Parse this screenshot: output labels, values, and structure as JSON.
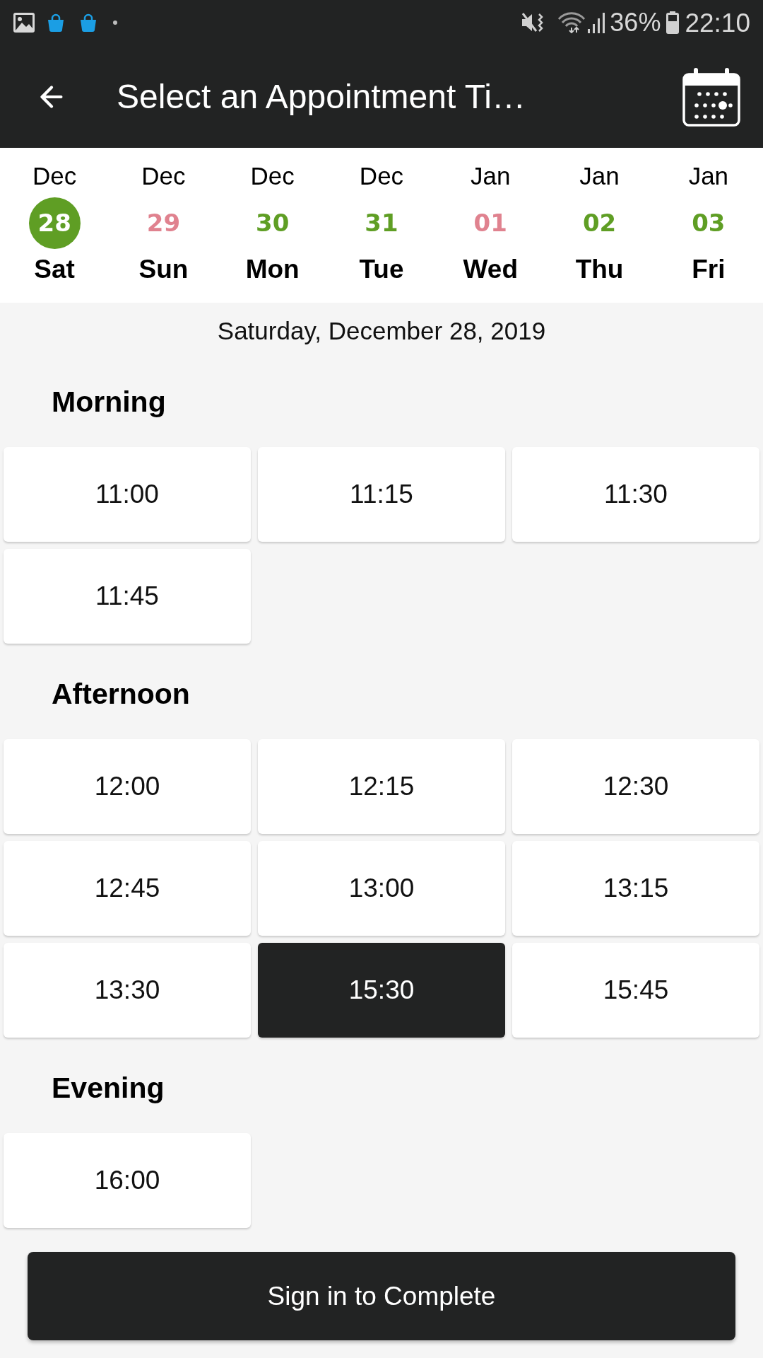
{
  "status_bar": {
    "battery": "36%",
    "time": "22:10"
  },
  "header": {
    "title": "Select an Appointment Ti…"
  },
  "days": [
    {
      "month": "Dec",
      "day": "28",
      "weekday": "Sat",
      "color": "#5f9e24",
      "selected": true
    },
    {
      "month": "Dec",
      "day": "29",
      "weekday": "Sun",
      "color": "#e0828f",
      "selected": false
    },
    {
      "month": "Dec",
      "day": "30",
      "weekday": "Mon",
      "color": "#5f9e24",
      "selected": false
    },
    {
      "month": "Dec",
      "day": "31",
      "weekday": "Tue",
      "color": "#5f9e24",
      "selected": false
    },
    {
      "month": "Jan",
      "day": "01",
      "weekday": "Wed",
      "color": "#e0828f",
      "selected": false
    },
    {
      "month": "Jan",
      "day": "02",
      "weekday": "Thu",
      "color": "#5f9e24",
      "selected": false
    },
    {
      "month": "Jan",
      "day": "03",
      "weekday": "Fri",
      "color": "#5f9e24",
      "selected": false
    }
  ],
  "date_label": "Saturday, December 28, 2019",
  "sections": [
    {
      "title": "Morning",
      "slots": [
        {
          "time": "11:00",
          "selected": false
        },
        {
          "time": "11:15",
          "selected": false
        },
        {
          "time": "11:30",
          "selected": false
        },
        {
          "time": "11:45",
          "selected": false
        }
      ]
    },
    {
      "title": "Afternoon",
      "slots": [
        {
          "time": "12:00",
          "selected": false
        },
        {
          "time": "12:15",
          "selected": false
        },
        {
          "time": "12:30",
          "selected": false
        },
        {
          "time": "12:45",
          "selected": false
        },
        {
          "time": "13:00",
          "selected": false
        },
        {
          "time": "13:15",
          "selected": false
        },
        {
          "time": "13:30",
          "selected": false
        },
        {
          "time": "15:30",
          "selected": true
        },
        {
          "time": "15:45",
          "selected": false
        }
      ]
    },
    {
      "title": "Evening",
      "slots": [
        {
          "time": "16:00",
          "selected": false
        }
      ]
    }
  ],
  "primary_button": "Sign in to Complete"
}
